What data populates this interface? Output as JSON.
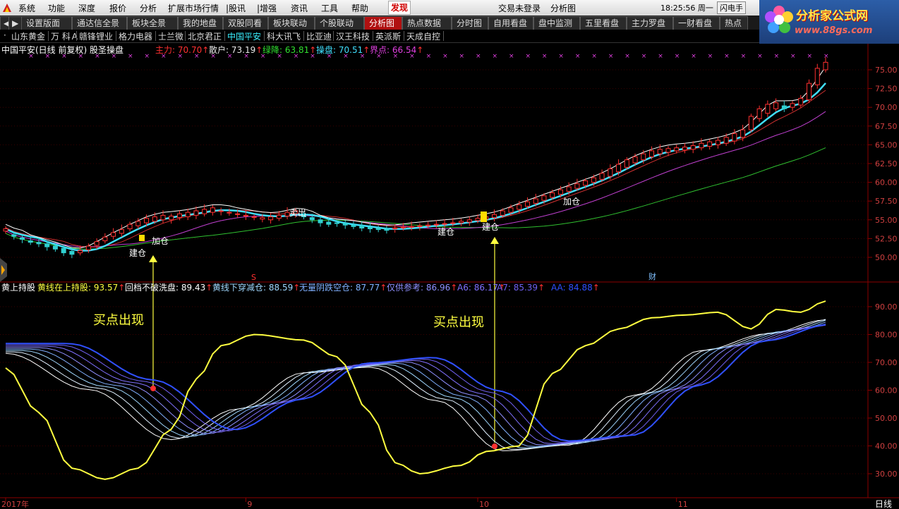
{
  "menubar": {
    "items": [
      "系统",
      "功能",
      "深度",
      "报价",
      "分析",
      "扩展市场行情",
      "|股讯",
      "|增强",
      "资讯",
      "工具",
      "帮助"
    ],
    "highlight": "发现",
    "status": "交易未登录",
    "view": "分析图",
    "clock": "18:25:56 周一",
    "quick": "闪电手"
  },
  "brand": {
    "name": "分析家公式网",
    "url": "www.88gs.com"
  },
  "tabs": [
    "设置版面",
    "通达信全景",
    "板块全景",
    "我的地盘",
    "双股同看",
    "板块联动",
    "个股联动",
    "分析图",
    "热点数据",
    "分时图",
    "自用看盘",
    "盘中监测",
    "五里看盘",
    "主力罗盘",
    "一财看盘",
    "热点"
  ],
  "active_tab": "分析图",
  "stocks": [
    "山东黄金",
    "万 科Ａ",
    "赣锋锂业",
    "格力电器",
    "士兰微",
    "北京君正",
    "中国平安",
    "科大讯飞",
    "比亚迪",
    "汉王科技",
    "英派斯",
    "天成自控"
  ],
  "active_stock": "中国平安",
  "main_panel": {
    "title": "中国平安(日线 前复权) 股圣操盘",
    "indicators": [
      {
        "label": "主力: ",
        "value": "70.70",
        "color": "#ff3030"
      },
      {
        "label": "散户: ",
        "value": "73.19",
        "color": "#e8e8e8"
      },
      {
        "label": "绿降: ",
        "value": "63.81",
        "color": "#30e030"
      },
      {
        "label": "操盘: ",
        "value": "70.51",
        "color": "#40e0ff"
      },
      {
        "label": "界点: ",
        "value": "66.54",
        "color": "#e040e0"
      }
    ],
    "y_ticks": [
      "75.00",
      "72.50",
      "70.00",
      "67.50",
      "65.00",
      "62.50",
      "60.00",
      "57.50",
      "55.00",
      "52.50",
      "50.00"
    ],
    "annotations": {
      "jiacang1": "加仓",
      "jiancang1": "建仓",
      "maichu": "卖出",
      "jiancang2": "建仓",
      "jiancang3": "建仓",
      "jiacang2": "加仓",
      "s_marker": "S",
      "cai_marker": "财"
    }
  },
  "sub_panel": {
    "title": "黄上持股",
    "indicators": [
      {
        "label": "黄线在上持股: ",
        "value": "93.57",
        "color": "#ffff40"
      },
      {
        "label": "回档不破洗盘: ",
        "value": "89.43",
        "color": "#ffffff"
      },
      {
        "label": "黄线下穿减仓: ",
        "value": "88.59",
        "color": "#a0d8ff"
      },
      {
        "label": "无量阴跌空仓: ",
        "value": "87.77",
        "color": "#80b0ff"
      },
      {
        "label": "仅供参考: ",
        "value": "86.96",
        "color": "#9090ff"
      },
      {
        "label": "A6: ",
        "value": "86.17",
        "color": "#8070ff"
      },
      {
        "label": "A7: ",
        "value": "85.39",
        "color": "#7060f0"
      },
      {
        "label": "AA: ",
        "value": "84.88",
        "color": "#3050ff"
      }
    ],
    "y_ticks": [
      "90.00",
      "80.00",
      "70.00",
      "60.00",
      "50.00",
      "40.00",
      "30.00"
    ],
    "buy_label_1": "买点出现",
    "buy_label_2": "买点出现"
  },
  "x_axis": {
    "labels": [
      "2017年",
      "9",
      "10",
      "11"
    ],
    "period": "日线"
  },
  "colors": {
    "up": "#ff3030",
    "down": "#30d0d0",
    "yellow": "#ffff40",
    "bg": "#000000"
  },
  "chart_data": {
    "type": "candlestick",
    "candle_count": 100,
    "price_range": [
      48.5,
      77.5
    ],
    "x_ticks": {
      "2017年": 0,
      "9": 29,
      "10": 57,
      "11": 81
    },
    "opens": [
      53.5,
      53.0,
      52.6,
      52.2,
      52.0,
      51.8,
      51.5,
      51.2,
      50.8,
      50.6,
      51.0,
      51.6,
      52.2,
      52.8,
      53.2,
      53.8,
      54.2,
      54.6,
      54.8,
      55.0,
      55.0,
      55.3,
      55.4,
      55.6,
      55.8,
      56.0,
      56.1,
      55.9,
      55.7,
      55.5,
      55.3,
      55.1,
      55.0,
      55.2,
      55.5,
      55.8,
      55.6,
      55.3,
      55.0,
      54.7,
      54.6,
      54.5,
      54.3,
      54.2,
      54.0,
      53.9,
      53.8,
      53.8,
      53.9,
      54.0,
      54.1,
      54.2,
      54.3,
      54.4,
      54.5,
      54.6,
      54.7,
      54.9,
      55.1,
      55.3,
      55.6,
      56.0,
      56.4,
      56.8,
      57.2,
      57.6,
      58.0,
      58.4,
      58.8,
      59.2,
      59.6,
      60.0,
      60.4,
      60.8,
      61.4,
      62.0,
      62.6,
      63.0,
      63.4,
      63.8,
      64.0,
      64.2,
      64.3,
      64.4,
      64.6,
      64.8,
      65.0,
      65.2,
      65.5,
      66.0,
      67.0,
      68.5,
      69.2,
      69.8,
      70.2,
      70.0,
      70.3,
      71.0,
      73.0,
      75.0
    ],
    "closes": [
      53.8,
      52.8,
      52.4,
      52.0,
      51.8,
      51.4,
      51.1,
      50.6,
      50.4,
      50.9,
      51.5,
      52.1,
      52.7,
      53.3,
      53.7,
      54.4,
      54.8,
      55.2,
      55.4,
      55.6,
      55.5,
      55.8,
      56.0,
      56.2,
      56.4,
      56.6,
      56.2,
      56.0,
      55.8,
      55.6,
      55.4,
      55.3,
      55.4,
      55.6,
      56.0,
      56.2,
      55.4,
      55.0,
      54.6,
      54.4,
      54.5,
      54.3,
      54.1,
      53.9,
      53.8,
      53.7,
      53.6,
      53.9,
      54.0,
      54.1,
      54.2,
      54.3,
      54.4,
      54.5,
      54.6,
      54.8,
      55.0,
      55.2,
      55.4,
      55.7,
      56.2,
      56.6,
      57.0,
      57.4,
      57.8,
      58.2,
      58.6,
      59.0,
      59.4,
      59.8,
      60.2,
      60.6,
      61.2,
      61.8,
      62.4,
      63.0,
      63.4,
      63.8,
      64.2,
      64.4,
      64.5,
      64.6,
      64.7,
      64.9,
      65.2,
      65.4,
      65.6,
      66.0,
      66.5,
      67.0,
      68.8,
      69.8,
      70.4,
      70.6,
      69.8,
      70.5,
      71.2,
      73.2,
      75.2,
      76.0
    ]
  }
}
